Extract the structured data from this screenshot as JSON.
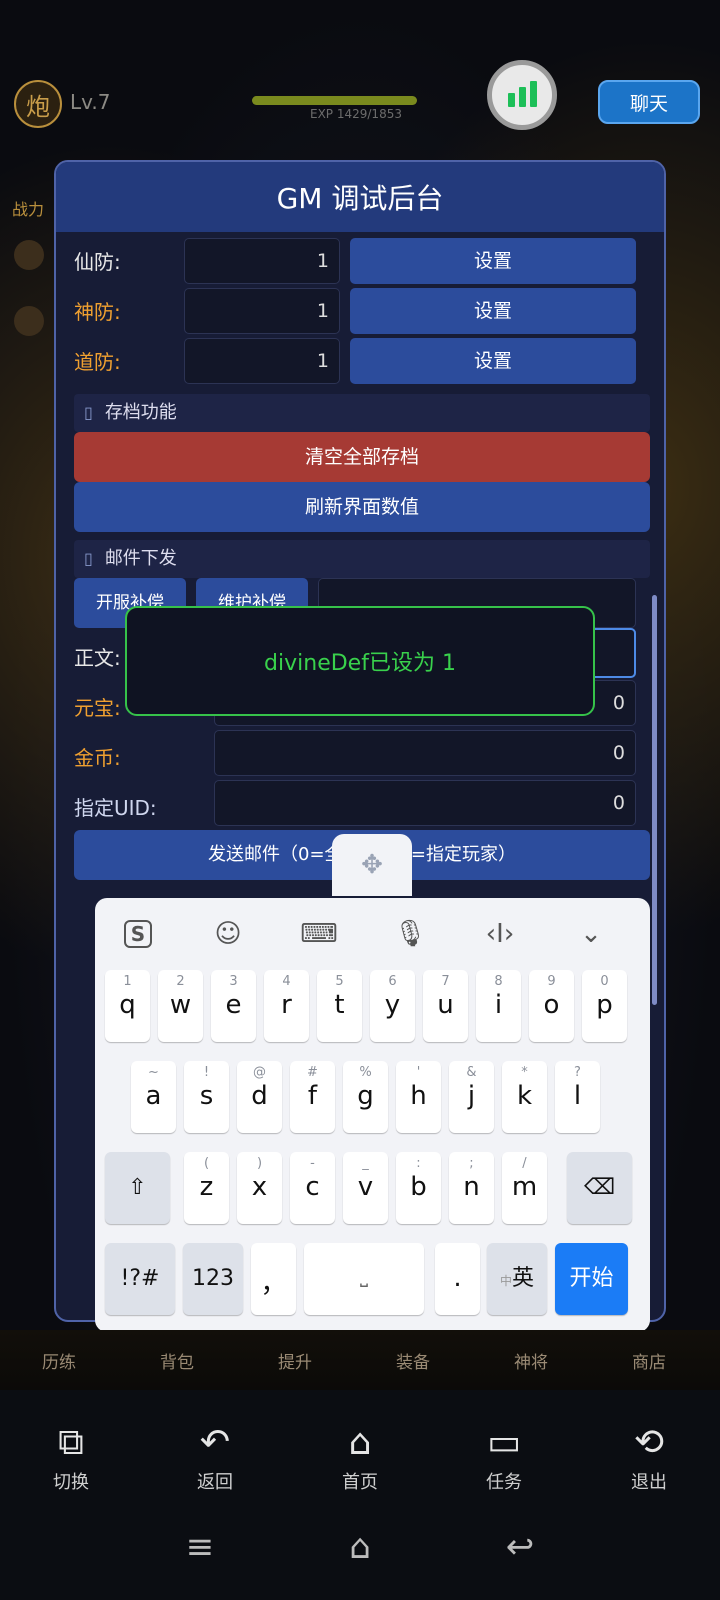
{
  "game": {
    "level_icon": "炮",
    "level": "Lv.7",
    "exp": "EXP 1429/1853",
    "exp_progress": 0.77,
    "chat_button": "聊天",
    "power_label": "战力",
    "nav_items": [
      "历练",
      "背包",
      "提升",
      "装备",
      "神将",
      "商店"
    ]
  },
  "gm": {
    "title": "GM 调试后台",
    "stats": [
      {
        "label": "仙防:",
        "value": "1",
        "button": "设置",
        "color": "#e8e8e8"
      },
      {
        "label": "神防:",
        "value": "1",
        "button": "设置",
        "color": "#f0a030"
      },
      {
        "label": "道防:",
        "value": "1",
        "button": "设置",
        "color": "#f0a030"
      }
    ],
    "save_section": {
      "title": "存档功能",
      "icon": "archive-icon"
    },
    "clear_save_button": "清空全部存档",
    "refresh_button": "刷新界面数值",
    "mail_section": {
      "title": "邮件下发",
      "icon": "mail-icon"
    },
    "mail_tabs": [
      "开服补偿",
      "维护补偿"
    ],
    "body_label": "正文:",
    "yuanbao": {
      "label": "元宝:",
      "value": "0"
    },
    "gold": {
      "label": "金币:",
      "value": "0"
    },
    "uid": {
      "label": "指定UID:",
      "value": "0"
    },
    "send_mail_button": "发送邮件（0=全服，UID=指定玩家）",
    "toast": "divineDef已设为 1"
  },
  "keyboard": {
    "toolbar": [
      "sogou-logo-icon",
      "emoji-icon",
      "keyboard-icon",
      "mic-icon",
      "cursor-icon",
      "collapse-icon"
    ],
    "row1": [
      [
        "1",
        "q"
      ],
      [
        "2",
        "w"
      ],
      [
        "3",
        "e"
      ],
      [
        "4",
        "r"
      ],
      [
        "5",
        "t"
      ],
      [
        "6",
        "y"
      ],
      [
        "7",
        "u"
      ],
      [
        "8",
        "i"
      ],
      [
        "9",
        "o"
      ],
      [
        "0",
        "p"
      ]
    ],
    "row2": [
      [
        "~",
        "a"
      ],
      [
        "!",
        "s"
      ],
      [
        "@",
        "d"
      ],
      [
        "#",
        "f"
      ],
      [
        "%",
        "g"
      ],
      [
        "'",
        "h"
      ],
      [
        "&",
        "j"
      ],
      [
        "*",
        "k"
      ],
      [
        "?",
        "l"
      ]
    ],
    "row3": [
      [
        "(",
        "z"
      ],
      [
        ")",
        "x"
      ],
      [
        "-",
        "c"
      ],
      [
        "_",
        "v"
      ],
      [
        ":",
        "b"
      ],
      [
        ";",
        "n"
      ],
      [
        "/",
        "m"
      ]
    ],
    "symbols_key": "!?#",
    "numbers_key": "123",
    "comma_key": "，",
    "period_key": ".",
    "lang_key_small": "中",
    "lang_key": "英",
    "start_key": "开始"
  },
  "app_bar": [
    {
      "icon": "switch-icon",
      "label": "切换"
    },
    {
      "icon": "back-icon",
      "label": "返回"
    },
    {
      "icon": "home-icon",
      "label": "首页"
    },
    {
      "icon": "tasks-icon",
      "label": "任务"
    },
    {
      "icon": "exit-icon",
      "label": "退出"
    }
  ]
}
